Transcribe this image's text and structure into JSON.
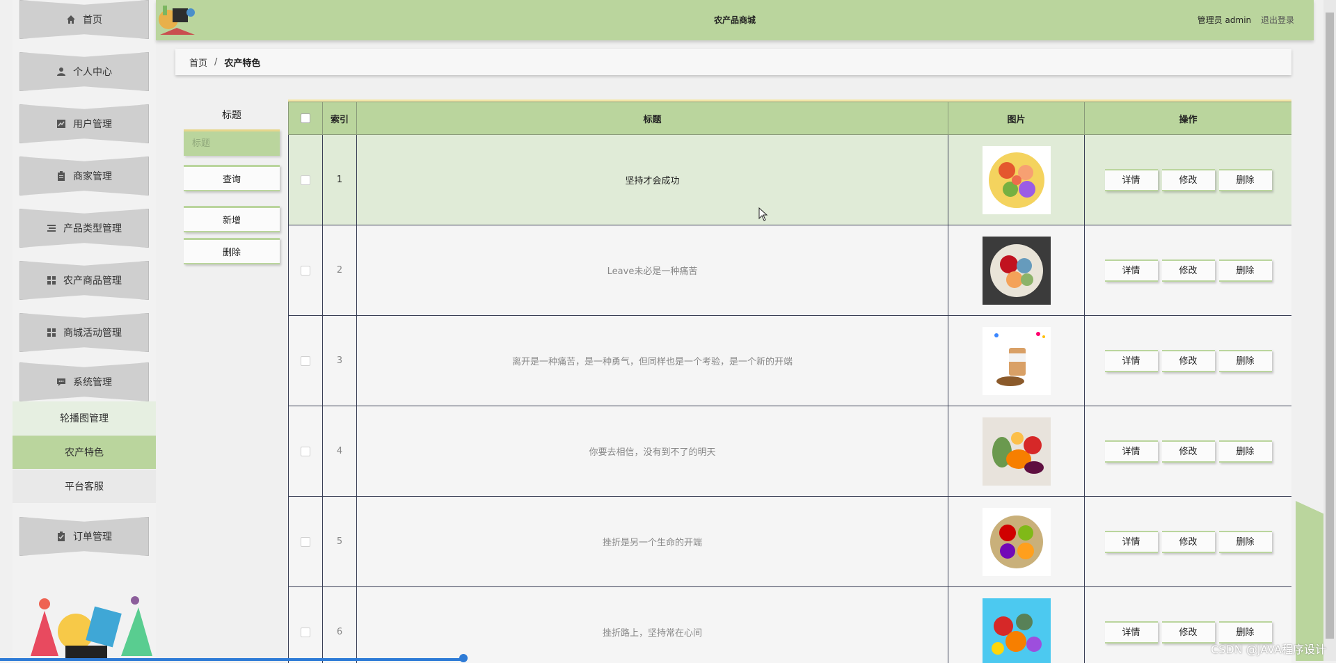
{
  "header": {
    "app_title": "农产品商城",
    "user_label": "管理员 admin",
    "logout_label": "退出登录"
  },
  "sidebar": {
    "items": [
      {
        "label": "首页",
        "icon": "home-icon"
      },
      {
        "label": "个人中心",
        "icon": "user-icon"
      },
      {
        "label": "用户管理",
        "icon": "chart-icon"
      },
      {
        "label": "商家管理",
        "icon": "clipboard-icon"
      },
      {
        "label": "产品类型管理",
        "icon": "list-icon"
      },
      {
        "label": "农产商品管理",
        "icon": "grid-icon"
      },
      {
        "label": "商城活动管理",
        "icon": "grid-icon"
      },
      {
        "label": "系统管理",
        "icon": "message-icon"
      },
      {
        "label": "订单管理",
        "icon": "clipboard-check-icon"
      }
    ],
    "submenu": [
      {
        "label": "轮播图管理"
      },
      {
        "label": "农产特色",
        "active": true
      },
      {
        "label": "平台客服"
      }
    ]
  },
  "breadcrumb": {
    "home": "首页",
    "separator": "/",
    "current": "农产特色"
  },
  "search": {
    "label": "标题",
    "placeholder": "标题",
    "query_button": "查询",
    "add_button": "新增",
    "delete_button": "删除"
  },
  "table": {
    "headers": {
      "index": "索引",
      "title": "标题",
      "image": "图片",
      "actions": "操作"
    },
    "action_labels": {
      "detail": "详情",
      "edit": "修改",
      "delete": "删除"
    },
    "rows": [
      {
        "index": "1",
        "title": "坚持才会成功",
        "image": "fruit-bowl-image"
      },
      {
        "index": "2",
        "title": "Leave未必是一种痛苦",
        "image": "fruit-bowl-image"
      },
      {
        "index": "3",
        "title": "离开是一种痛苦，是一种勇气，但同样也是一个考验，是一个新的开端",
        "image": "snack-jar-image"
      },
      {
        "index": "4",
        "title": "你要去相信，没有到不了的明天",
        "image": "vegetables-image"
      },
      {
        "index": "5",
        "title": "挫折是另一个生命的开端",
        "image": "fruit-bowl-image"
      },
      {
        "index": "6",
        "title": "挫折路上，坚持常在心间",
        "image": "vegetables-image"
      }
    ]
  },
  "watermark": "CSDN @JAVA程序设计",
  "colors": {
    "accent": "#bad59d",
    "accent_border": "#e6d68c",
    "sidebar_item": "#cfcfcf",
    "row_highlight": "#e0ebd7"
  }
}
